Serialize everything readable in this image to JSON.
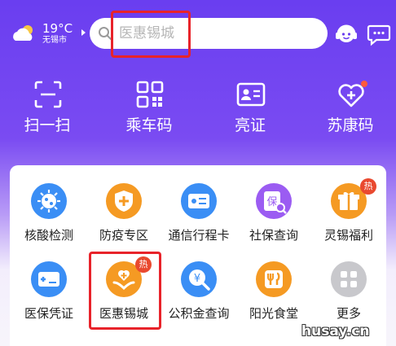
{
  "weather": {
    "temperature": "19°C",
    "city": "无锡市",
    "icon": "cloud-sun-icon"
  },
  "search": {
    "placeholder": "医惠锡城",
    "icon": "search-icon"
  },
  "header_icons": [
    "customer-service-icon",
    "message-icon"
  ],
  "quick_actions": [
    {
      "label": "扫一扫",
      "icon": "scan-icon"
    },
    {
      "label": "乘车码",
      "icon": "qr-code-icon"
    },
    {
      "label": "亮证",
      "icon": "id-card-icon"
    },
    {
      "label": "苏康码",
      "icon": "health-heart-icon"
    }
  ],
  "services": [
    {
      "label": "核酸检测",
      "icon": "virus-icon",
      "color": "#3a8ef5"
    },
    {
      "label": "防疫专区",
      "icon": "shield-plus-icon",
      "color": "#f59a23"
    },
    {
      "label": "通信行程卡",
      "icon": "travel-card-icon",
      "color": "#3a8ef5"
    },
    {
      "label": "社保查询",
      "icon": "insurance-search-icon",
      "color": "#9b5cf2"
    },
    {
      "label": "灵锡福利",
      "icon": "gift-icon",
      "color": "#f59a23",
      "badge": "热"
    },
    {
      "label": "医保凭证",
      "icon": "medical-card-icon",
      "color": "#3a8ef5"
    },
    {
      "label": "医惠锡城",
      "icon": "medical-hands-icon",
      "color": "#f59a23",
      "badge": "热"
    },
    {
      "label": "公积金查询",
      "icon": "fund-search-icon",
      "color": "#3a8ef5"
    },
    {
      "label": "阳光食堂",
      "icon": "dining-icon",
      "color": "#f59a23"
    },
    {
      "label": "更多",
      "icon": "grid-more-icon",
      "color": "#c8c8cc"
    }
  ],
  "watermark": "husay.cn"
}
